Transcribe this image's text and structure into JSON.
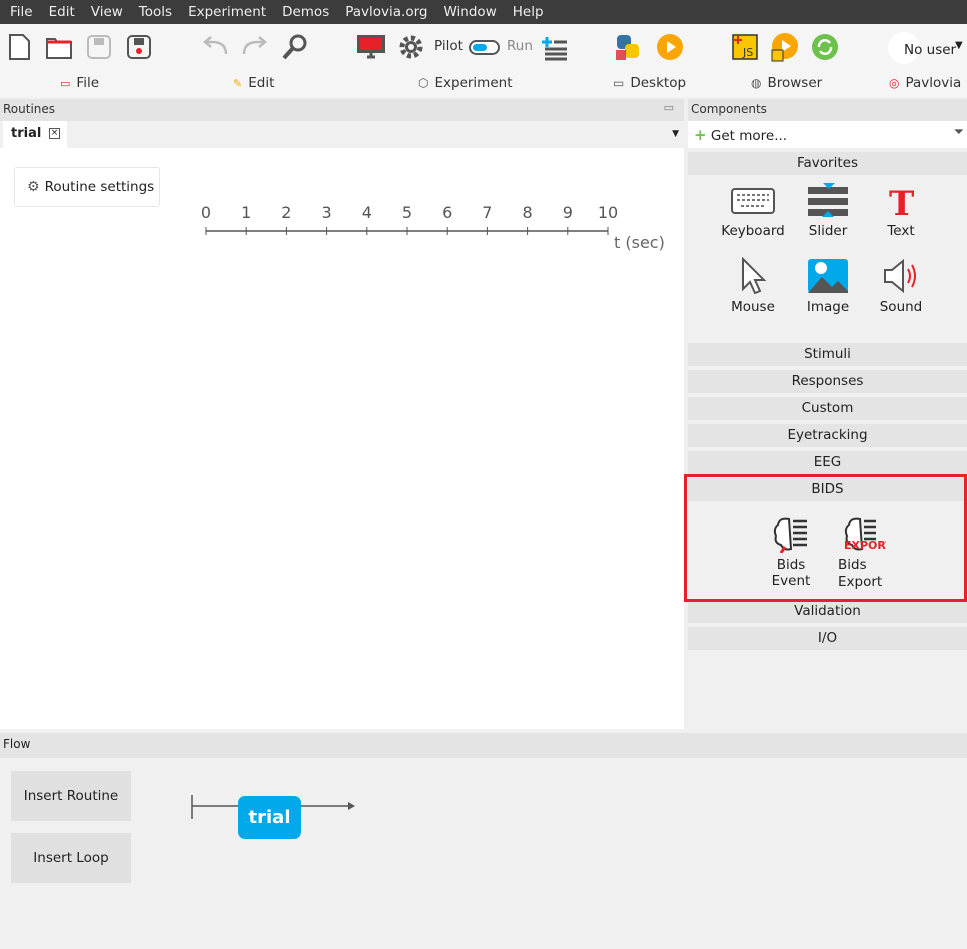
{
  "menu": [
    "File",
    "Edit",
    "View",
    "Tools",
    "Experiment",
    "Demos",
    "Pavlovia.org",
    "Window",
    "Help"
  ],
  "toolbar": {
    "pilot_label": "Pilot",
    "run_label": "Run",
    "user_label": "No user"
  },
  "switcher": {
    "file": "File",
    "edit": "Edit",
    "experiment": "Experiment",
    "desktop": "Desktop",
    "browser": "Browser",
    "pavlovia": "Pavlovia"
  },
  "routines": {
    "header": "Routines",
    "tab": "trial",
    "settings_button": "Routine settings",
    "timeline_ticks": [
      "0",
      "1",
      "2",
      "3",
      "4",
      "5",
      "6",
      "7",
      "8",
      "9",
      "10"
    ],
    "timeline_unit": "t (sec)"
  },
  "components": {
    "header": "Components",
    "get_more": "Get more...",
    "categories": {
      "favorites": "Favorites",
      "stimuli": "Stimuli",
      "responses": "Responses",
      "custom": "Custom",
      "eyetracking": "Eyetracking",
      "eeg": "EEG",
      "bids": "BIDS",
      "validation": "Validation",
      "io": "I/O"
    },
    "favorites": [
      "Keyboard",
      "Slider",
      "Text",
      "Mouse",
      "Image",
      "Sound"
    ],
    "bids_items": [
      "Bids Event",
      "Bids Export"
    ],
    "bids_export_badge": "EXPORT",
    "highlight_color": "#e8202a"
  },
  "flow": {
    "header": "Flow",
    "insert_routine": "Insert Routine",
    "insert_loop": "Insert Loop",
    "routine_label": "trial",
    "routine_color": "#02a9ea"
  },
  "colors": {
    "menubar": "#3c3c3c",
    "accent_orange": "#f9a602",
    "accent_green": "#6cc24a"
  }
}
